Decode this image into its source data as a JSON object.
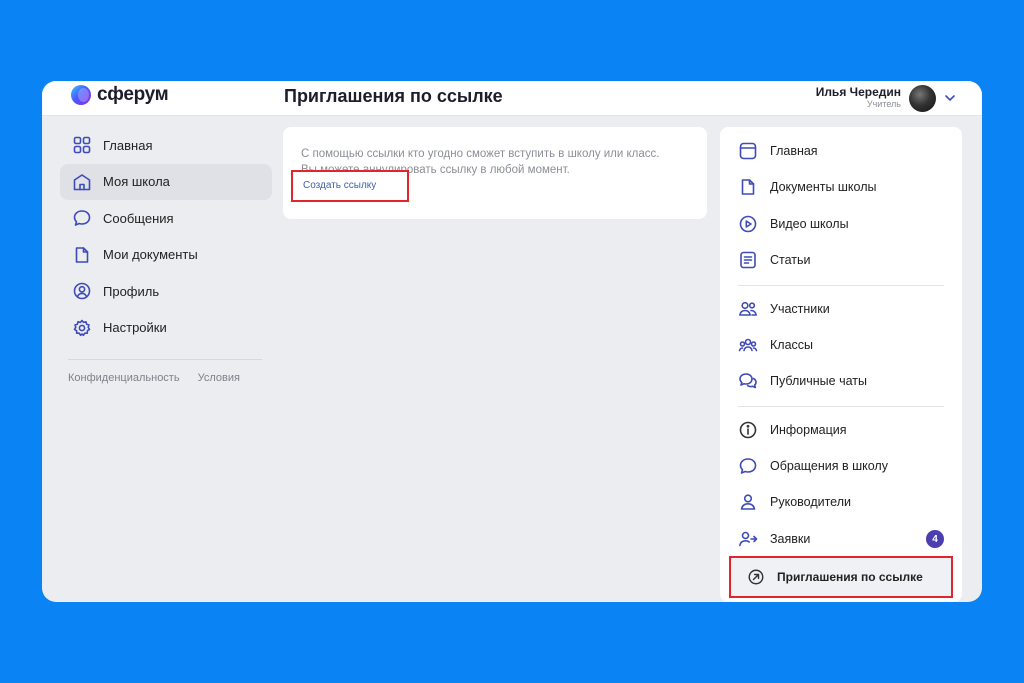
{
  "app": {
    "brand": "сферум",
    "page_title": "Приглашения по ссылке"
  },
  "user": {
    "name": "Илья Чередин",
    "role": "Учитель"
  },
  "left_nav": {
    "items": [
      {
        "label": "Главная",
        "icon": "grid-icon"
      },
      {
        "label": "Моя школа",
        "icon": "school-icon",
        "active": true
      },
      {
        "label": "Сообщения",
        "icon": "chat-icon"
      },
      {
        "label": "Мои документы",
        "icon": "document-icon"
      },
      {
        "label": "Профиль",
        "icon": "profile-icon"
      },
      {
        "label": "Настройки",
        "icon": "gear-icon"
      }
    ],
    "footer": {
      "privacy": "Конфиденциальность",
      "terms": "Условия"
    }
  },
  "card": {
    "text": "С помощью ссылки кто угодно сможет вступить в школу или класс. Вы можете аннулировать ссылку в любой момент.",
    "link_label": "Создать ссылку"
  },
  "right_nav": {
    "items": [
      {
        "label": "Главная",
        "icon": "home-icon"
      },
      {
        "label": "Документы школы",
        "icon": "document-icon"
      },
      {
        "label": "Видео школы",
        "icon": "play-icon"
      },
      {
        "label": "Статьи",
        "icon": "article-icon"
      },
      {
        "label": "Участники",
        "icon": "users-icon"
      },
      {
        "label": "Классы",
        "icon": "classes-icon"
      },
      {
        "label": "Публичные чаты",
        "icon": "public-chats-icon"
      },
      {
        "label": "Информация",
        "icon": "info-icon"
      },
      {
        "label": "Обращения в школу",
        "icon": "chat-icon"
      },
      {
        "label": "Руководители",
        "icon": "person-icon"
      },
      {
        "label": "Заявки",
        "icon": "user-requests-icon",
        "badge": "4"
      }
    ],
    "selected": {
      "label": "Приглашения по ссылке",
      "icon": "arrow-circle-icon"
    }
  },
  "colors": {
    "background": "#0a84f5",
    "accent": "#3f4bb8",
    "highlight": "#e0252d",
    "badge": "#4b3fb0"
  }
}
